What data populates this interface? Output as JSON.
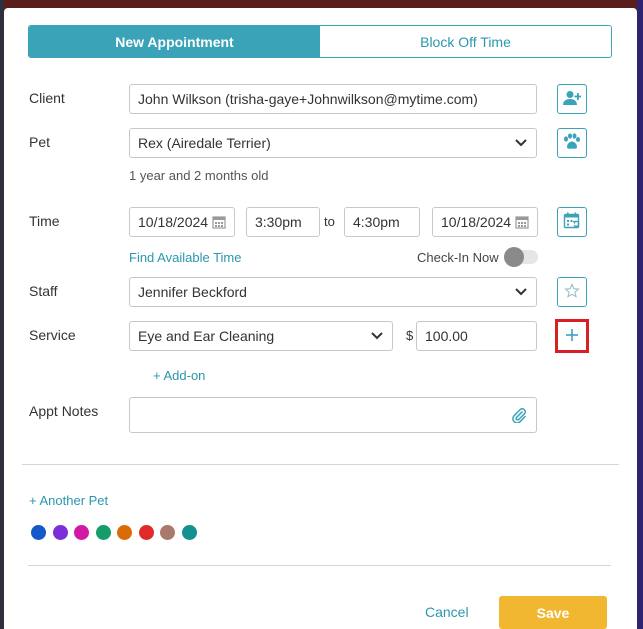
{
  "tabs": {
    "new_appointment": "New Appointment",
    "block_off_time": "Block Off Time"
  },
  "client": {
    "label": "Client",
    "value": "John Wilkson (trisha-gaye+Johnwilkson@mytime.com)",
    "add_icon": "add-user-icon"
  },
  "pet": {
    "label": "Pet",
    "value": "Rex (Airedale Terrier)",
    "age": "1 year and 2 months old",
    "add_icon": "paw-plus-icon"
  },
  "time": {
    "label": "Time",
    "start_date": "10/18/2024",
    "start_time": "3:30pm",
    "to": "to",
    "end_time": "4:30pm",
    "end_date": "10/18/2024",
    "find_available": "Find Available Time",
    "check_in": "Check-In Now",
    "check_in_on": false,
    "calendar_icon": "calendar-refresh-icon"
  },
  "staff": {
    "label": "Staff",
    "value": "Jennifer Beckford",
    "favorite_icon": "star-icon"
  },
  "service": {
    "label": "Service",
    "value": "Eye and Ear Cleaning",
    "currency": "$",
    "price": "100.00",
    "add_icon": "plus-icon",
    "add_on": "+ Add-on"
  },
  "notes": {
    "label": "Appt Notes",
    "value": "",
    "attach_icon": "paperclip-icon"
  },
  "another_pet": "+ Another Pet",
  "colors": [
    "#1558c9",
    "#7b2fd6",
    "#d219a6",
    "#159c6a",
    "#d96c08",
    "#e02a2a",
    "#a97a6c",
    "#14908f"
  ],
  "footer": {
    "cancel": "Cancel",
    "save": "Save"
  },
  "accent": "#3aa3b8",
  "save_color": "#f2b731",
  "highlight": "#d81f26"
}
